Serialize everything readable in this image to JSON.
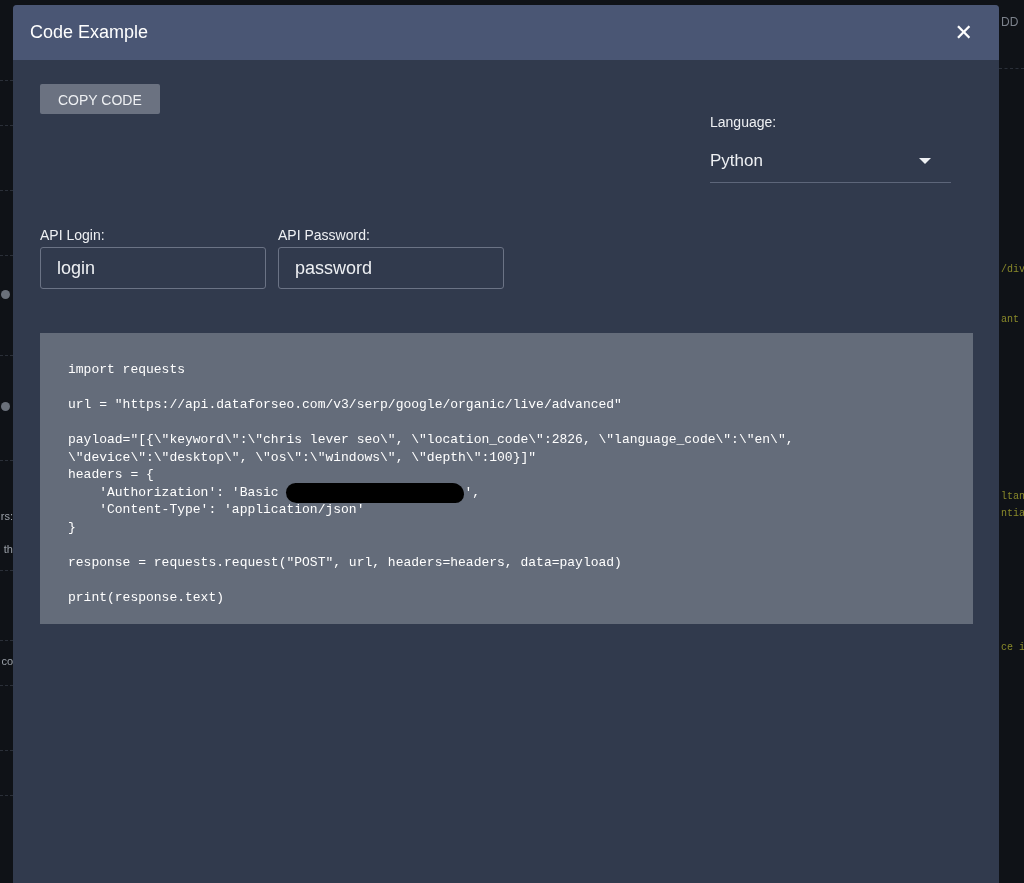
{
  "background": {
    "left_fragments": [
      "rs:",
      "th",
      "co"
    ],
    "right_fragments": [
      "DD",
      "/div",
      "ant",
      "ltan",
      "ntia",
      "ce i"
    ]
  },
  "dialog": {
    "title": "Code Example",
    "close": "✕",
    "copy_button": "COPY CODE",
    "language": {
      "label": "Language:",
      "value": "Python"
    },
    "fields": [
      {
        "label": "API Login:",
        "value": "login"
      },
      {
        "label": "API Password:",
        "value": "password"
      }
    ],
    "code_lines": [
      {
        "kind": "text",
        "text": "import requests"
      },
      {
        "kind": "blank"
      },
      {
        "kind": "text",
        "text": "url = \"https://api.dataforseo.com/v3/serp/google/organic/live/advanced\""
      },
      {
        "kind": "blank"
      },
      {
        "kind": "text",
        "text": "payload=\"[{\\\"keyword\\\":\\\"chris lever seo\\\", \\\"location_code\\\":2826, \\\"language_code\\\":\\\"en\\\","
      },
      {
        "kind": "text",
        "text": "\\\"device\\\":\\\"desktop\\\", \\\"os\\\":\\\"windows\\\", \\\"depth\\\":100}]\""
      },
      {
        "kind": "text",
        "text": "headers = {"
      },
      {
        "kind": "redacted",
        "before": "    'Authorization': 'Basic ",
        "after": "',"
      },
      {
        "kind": "text",
        "text": "    'Content-Type': 'application/json'"
      },
      {
        "kind": "text",
        "text": "}"
      },
      {
        "kind": "blank"
      },
      {
        "kind": "text",
        "text": "response = requests.request(\"POST\", url, headers=headers, data=payload)"
      },
      {
        "kind": "blank"
      },
      {
        "kind": "text",
        "text": "print(response.text)"
      }
    ]
  }
}
